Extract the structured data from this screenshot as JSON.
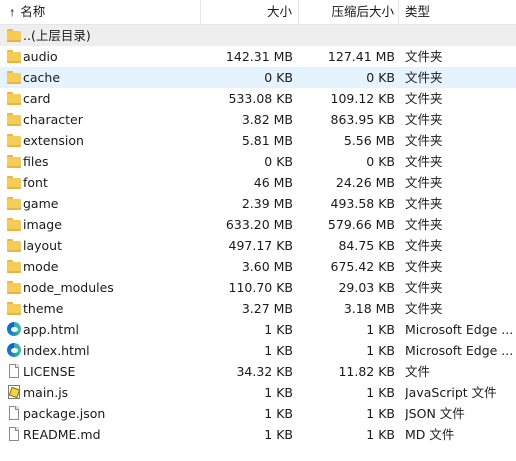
{
  "columns": {
    "name": "名称",
    "size": "大小",
    "compressed": "压缩后大小",
    "type": "类型"
  },
  "sort_icon": "sort-ascending-icon",
  "colors": {
    "folder": "#f6cc59",
    "parent_row_bg": "#eeeeee",
    "hover_row_bg": "#e5f3ff"
  },
  "rows": [
    {
      "name": "..(上层目录)",
      "size": "",
      "compressed": "",
      "type": "",
      "icon": "folder-icon"
    },
    {
      "name": "audio",
      "size": "142.31 MB",
      "compressed": "127.41 MB",
      "type": "文件夹",
      "icon": "folder-icon"
    },
    {
      "name": "cache",
      "size": "0 KB",
      "compressed": "0 KB",
      "type": "文件夹",
      "icon": "folder-icon"
    },
    {
      "name": "card",
      "size": "533.08 KB",
      "compressed": "109.12 KB",
      "type": "文件夹",
      "icon": "folder-icon"
    },
    {
      "name": "character",
      "size": "3.82 MB",
      "compressed": "863.95 KB",
      "type": "文件夹",
      "icon": "folder-icon"
    },
    {
      "name": "extension",
      "size": "5.81 MB",
      "compressed": "5.56 MB",
      "type": "文件夹",
      "icon": "folder-icon"
    },
    {
      "name": "files",
      "size": "0 KB",
      "compressed": "0 KB",
      "type": "文件夹",
      "icon": "folder-icon"
    },
    {
      "name": "font",
      "size": "46 MB",
      "compressed": "24.26 MB",
      "type": "文件夹",
      "icon": "folder-icon"
    },
    {
      "name": "game",
      "size": "2.39 MB",
      "compressed": "493.58 KB",
      "type": "文件夹",
      "icon": "folder-icon"
    },
    {
      "name": "image",
      "size": "633.20 MB",
      "compressed": "579.66 MB",
      "type": "文件夹",
      "icon": "folder-icon"
    },
    {
      "name": "layout",
      "size": "497.17 KB",
      "compressed": "84.75 KB",
      "type": "文件夹",
      "icon": "folder-icon"
    },
    {
      "name": "mode",
      "size": "3.60 MB",
      "compressed": "675.42 KB",
      "type": "文件夹",
      "icon": "folder-icon"
    },
    {
      "name": "node_modules",
      "size": "110.70 KB",
      "compressed": "29.03 KB",
      "type": "文件夹",
      "icon": "folder-icon"
    },
    {
      "name": "theme",
      "size": "3.27 MB",
      "compressed": "3.18 MB",
      "type": "文件夹",
      "icon": "folder-icon"
    },
    {
      "name": "app.html",
      "size": "1 KB",
      "compressed": "1 KB",
      "type": "Microsoft Edge ...",
      "icon": "edge-icon"
    },
    {
      "name": "index.html",
      "size": "1 KB",
      "compressed": "1 KB",
      "type": "Microsoft Edge ...",
      "icon": "edge-icon"
    },
    {
      "name": "LICENSE",
      "size": "34.32 KB",
      "compressed": "11.82 KB",
      "type": "文件",
      "icon": "file-icon"
    },
    {
      "name": "main.js",
      "size": "1 KB",
      "compressed": "1 KB",
      "type": "JavaScript 文件",
      "icon": "js-file-icon"
    },
    {
      "name": "package.json",
      "size": "1 KB",
      "compressed": "1 KB",
      "type": "JSON 文件",
      "icon": "file-icon"
    },
    {
      "name": "README.md",
      "size": "1 KB",
      "compressed": "1 KB",
      "type": "MD 文件",
      "icon": "file-icon"
    }
  ]
}
